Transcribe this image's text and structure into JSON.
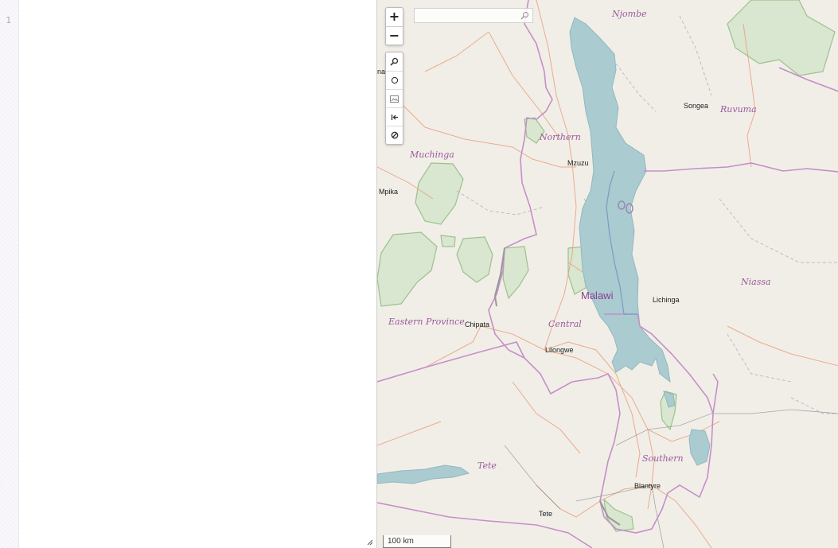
{
  "editor": {
    "line_number": "1"
  },
  "map": {
    "search": {
      "placeholder": ""
    },
    "zoom": {
      "in_label": "+",
      "out_label": "−"
    },
    "scale_label": "100 km",
    "colors": {
      "land": "#f1eee8",
      "water": "#aacbd0",
      "park": "#d9e6d0",
      "park_edge": "#9cc28c",
      "border": "#c58fc8",
      "road": "#e9a07d"
    },
    "labels": {
      "njombe": "Njombe",
      "songea": "Songea",
      "ruvuma": "Ruvuma",
      "northern": "Northern",
      "mzuzu": "Mzuzu",
      "muchinga": "Muchinga",
      "mpika": "Mpika",
      "na": "na",
      "malawi": "Malawi",
      "lichinga": "Lichinga",
      "niassa": "Niassa",
      "eastern_province": "Eastern Province",
      "chipata": "Chipata",
      "central": "Central",
      "lilongwe": "Lilongwe",
      "southern": "Southern",
      "blantyre": "Blantyre",
      "tete_region": "Tete",
      "tete_city": "Tete"
    }
  }
}
